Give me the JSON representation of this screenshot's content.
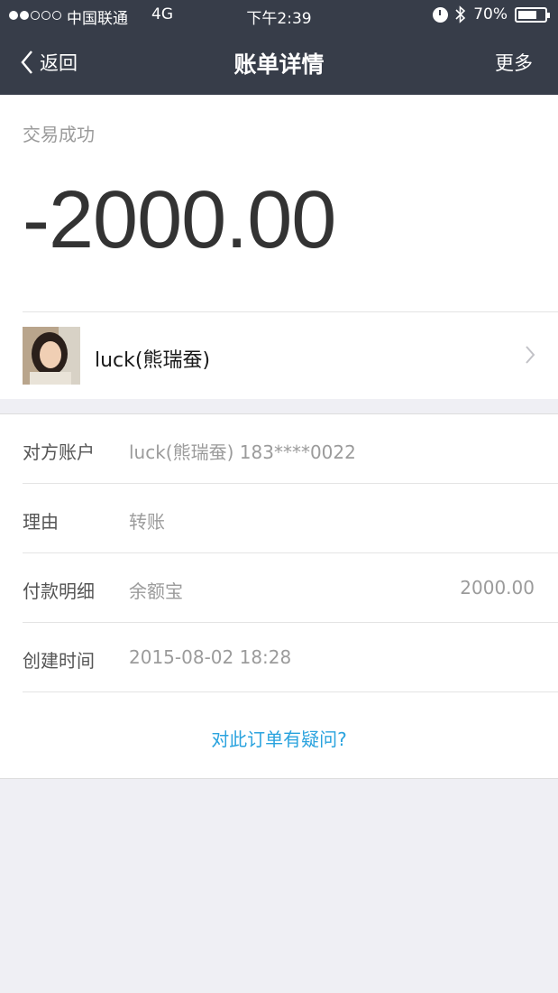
{
  "status_bar": {
    "carrier": "中国联通",
    "network": "4G",
    "time": "下午2:39",
    "battery": "70%",
    "battery_level": 0.7
  },
  "nav": {
    "back_label": "返回",
    "title": "账单详情",
    "more_label": "更多"
  },
  "summary": {
    "status": "交易成功",
    "amount": "-2000.00"
  },
  "counterparty": {
    "name": "luck(熊瑞蚕)"
  },
  "details": {
    "rows": [
      {
        "label": "对方账户",
        "value": "luck(熊瑞蚕) 183****0022",
        "amount": ""
      },
      {
        "label": "理由",
        "value": "转账",
        "amount": ""
      },
      {
        "label": "付款明细",
        "value": "余额宝",
        "amount": "2000.00"
      },
      {
        "label": "创建时间",
        "value": "2015-08-02 18:28",
        "amount": ""
      }
    ],
    "question_link": "对此订单有疑问?"
  },
  "colors": {
    "nav_background": "#373d49",
    "link": "#2aa3de",
    "page_background": "#efeff4"
  }
}
